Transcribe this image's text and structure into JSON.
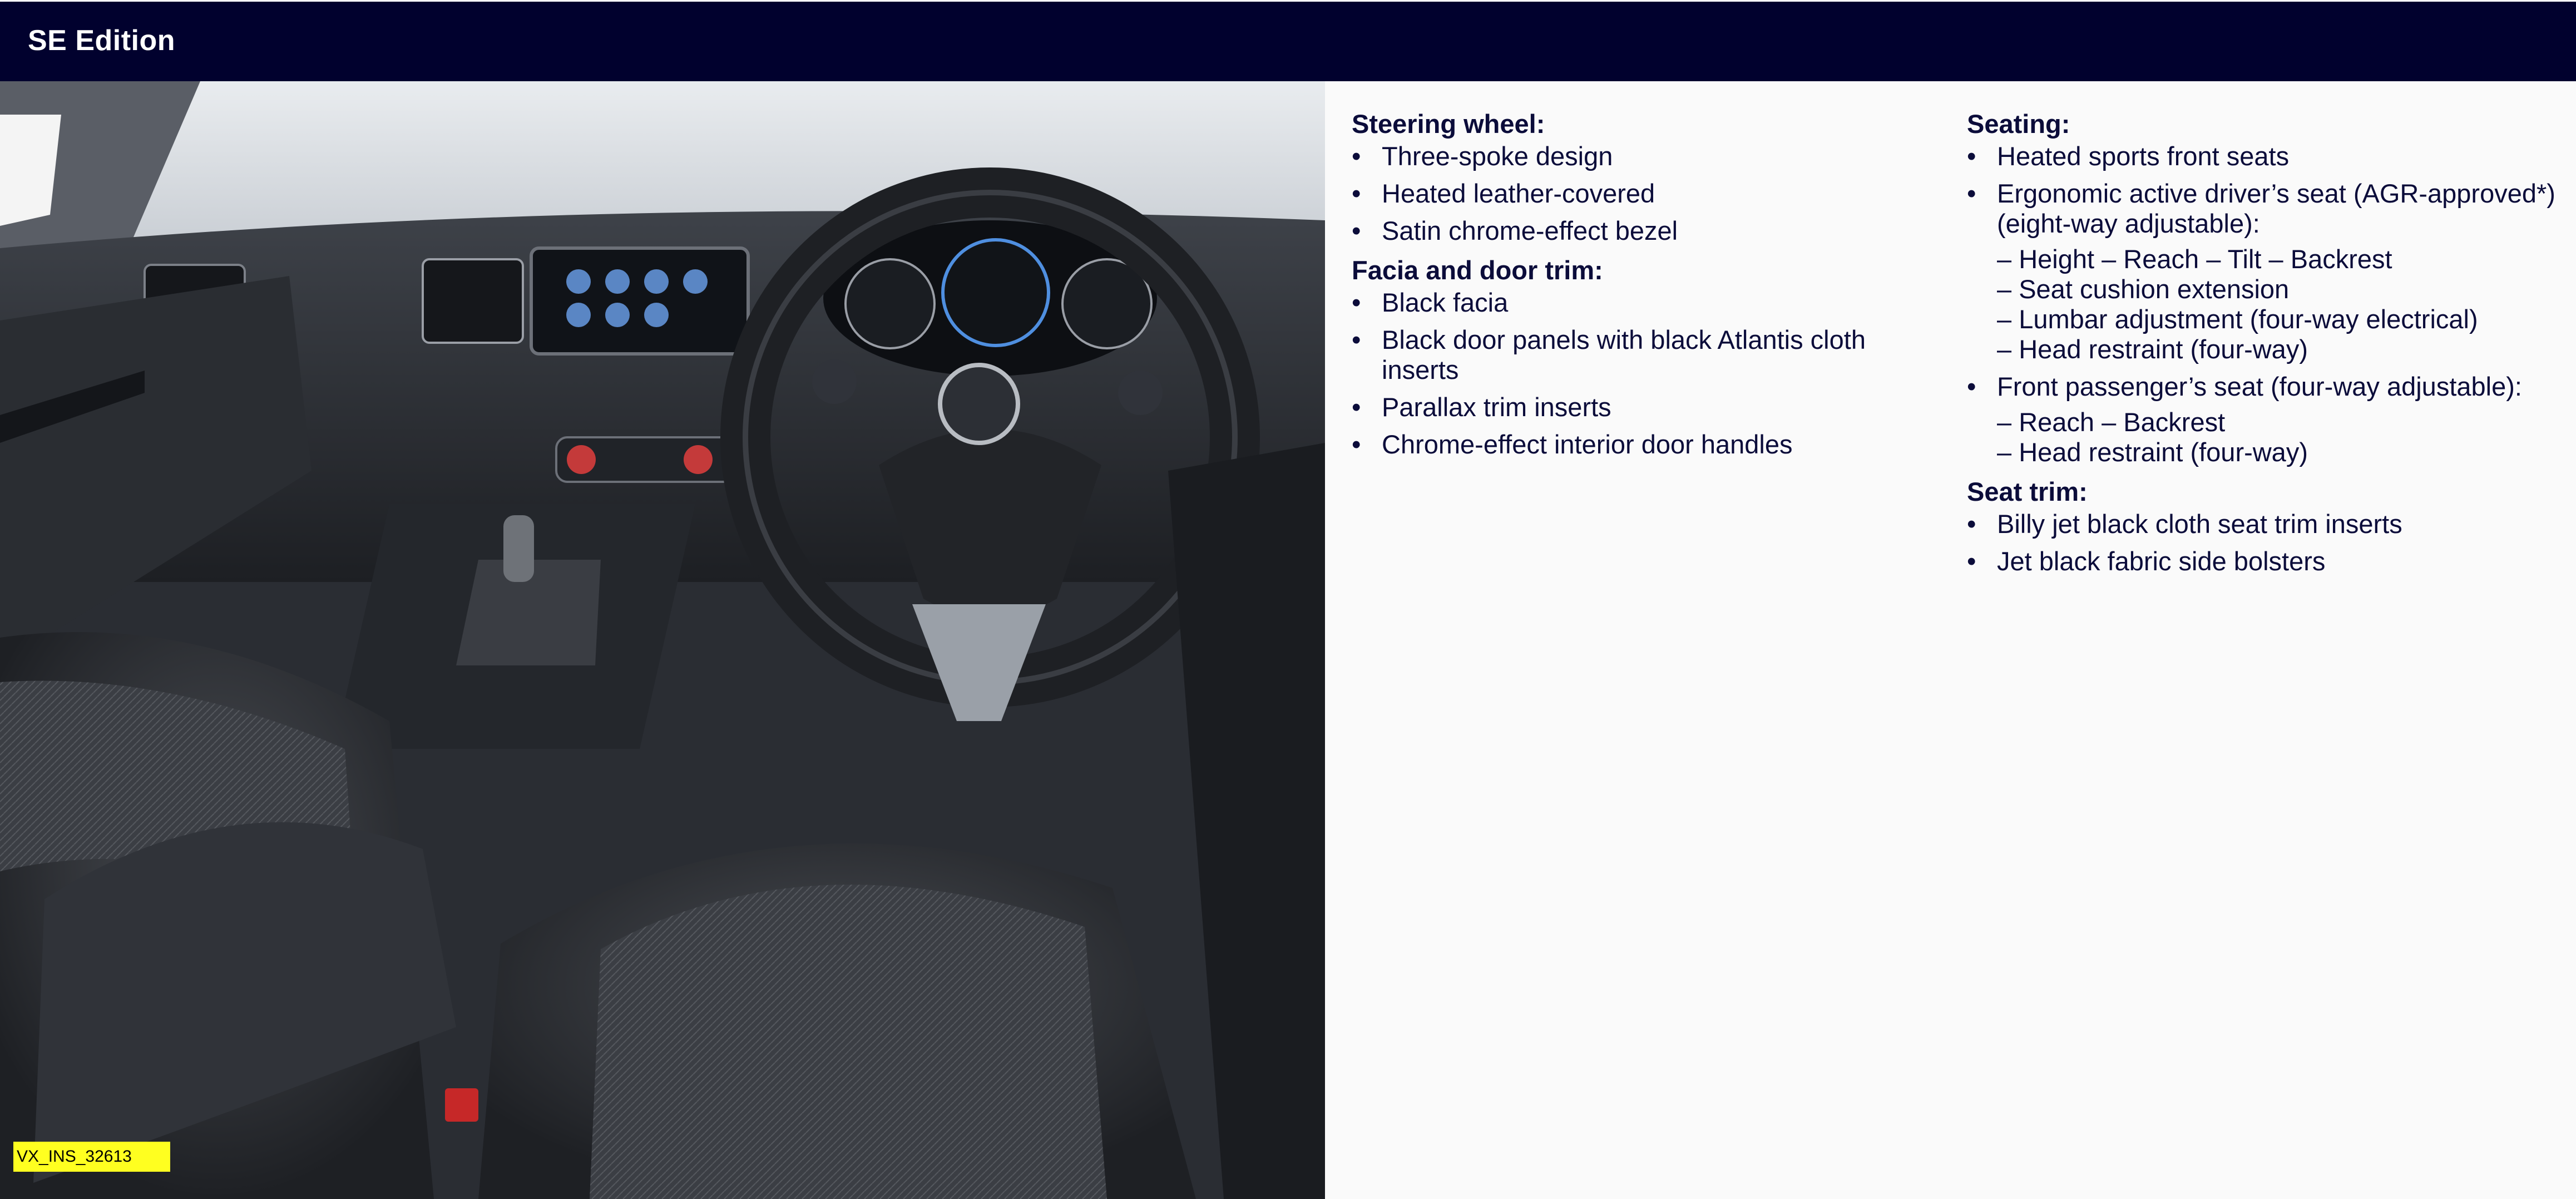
{
  "header": {
    "title": "SE Edition"
  },
  "image_tag": "VX_INS_32613",
  "bullet_glyph": "•",
  "steering": {
    "heading": "Steering wheel:",
    "items": [
      "Three-spoke design",
      "Heated leather-covered",
      "Satin chrome-effect bezel"
    ]
  },
  "facia": {
    "heading": "Facia and door trim:",
    "items": [
      "Black facia",
      "Black door panels with black Atlantis cloth inserts",
      "Parallax trim inserts",
      "Chrome-effect interior door handles"
    ]
  },
  "seating": {
    "heading": "Seating:",
    "item1": "Heated sports front seats",
    "item2": "Ergonomic active driver’s seat (AGR-approved*) (eight-way adjustable):",
    "item2_subs": [
      "– Height  – Reach  – Tilt  – Backrest",
      "– Seat cushion extension",
      "– Lumbar adjustment (four-way electrical)",
      "– Head restraint (four-way)"
    ],
    "item3": "Front passenger’s seat (four-way adjustable):",
    "item3_subs": [
      "– Reach  – Backrest",
      "– Head restraint (four-way)"
    ]
  },
  "seat_trim": {
    "heading": "Seat trim:",
    "items": [
      "Billy jet black cloth seat trim inserts",
      "Jet black fabric side bolsters"
    ]
  },
  "colors": {
    "header_bg": "#01012e",
    "text": "#0b0c3a",
    "tag_bg": "#ffff20"
  }
}
